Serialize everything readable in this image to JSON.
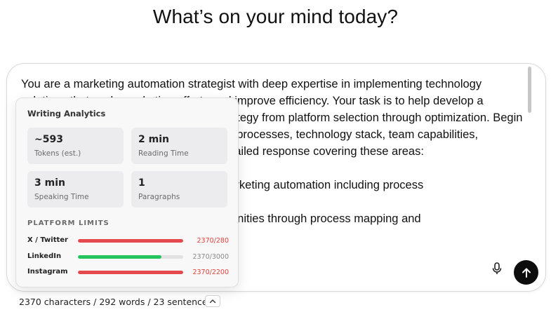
{
  "header": {
    "title": "What’s on your mind today?"
  },
  "composer": {
    "lines": [
      "You are a marketing automation strategist with deep expertise in implementing technology",
      "solutions that scale marketing efforts and improve efficiency. Your task is to help develop a",
      "comprehensive marketing automation strategy from platform selection through optimization. Begin",
      "by asking me about my current marketing processes, technology stack, team capabilities,",
      "and automation goals. Then provide a detailed response covering these areas:",
      "",
      "1. Assess organizational readiness for marketing automation including process",
      "",
      "2. Identify high-impact automation opportunities through process mapping and"
    ]
  },
  "analytics": {
    "title": "Writing Analytics",
    "stats": [
      {
        "value": "~593",
        "label": "Tokens (est.)"
      },
      {
        "value": "2 min",
        "label": "Reading Time"
      },
      {
        "value": "3 min",
        "label": "Speaking Time"
      },
      {
        "value": "1",
        "label": "Paragraphs"
      }
    ],
    "limits_heading": "PLATFORM LIMITS",
    "limits": [
      {
        "name": "X / Twitter",
        "value": "2370/280",
        "fill_fraction": 1.0,
        "color": "#e5484d",
        "over": true
      },
      {
        "name": "LinkedIn",
        "value": "2370/3000",
        "fill_fraction": 0.79,
        "color": "#22c55e",
        "over": false
      },
      {
        "name": "Instagram",
        "value": "2370/2200",
        "fill_fraction": 1.0,
        "color": "#e5484d",
        "over": true
      }
    ]
  },
  "footer": {
    "stats": "2370 characters / 292 words / 23 sentences"
  },
  "icons": {
    "mic": "microphone-icon",
    "send": "arrow-up-icon",
    "toggle": "chevron-up-icon"
  }
}
